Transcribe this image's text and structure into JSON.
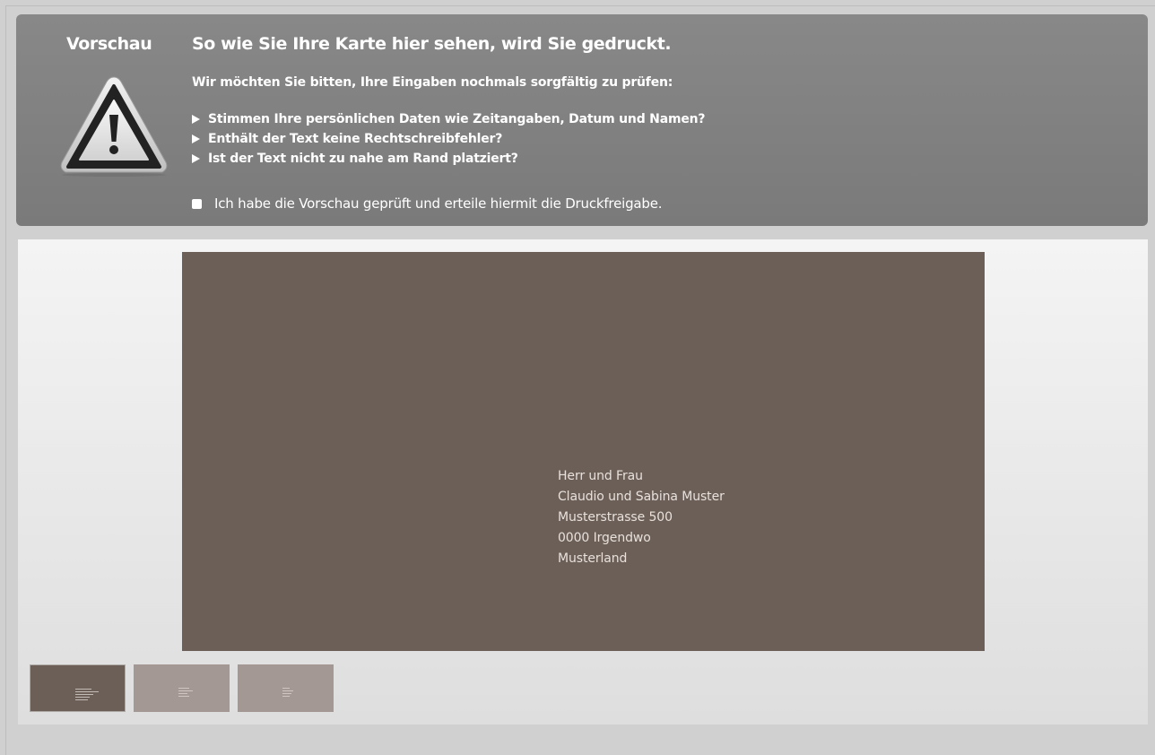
{
  "notice": {
    "label": "Vorschau",
    "title": "So wie Sie Ihre Karte hier sehen, wird Sie gedruckt.",
    "intro": "Wir möchten Sie bitten, Ihre Eingaben nochmals sorgfältig zu prüfen:",
    "checklist": [
      "Stimmen Ihre persönlichen Daten wie Zeitangaben, Datum und Namen?",
      "Enthält der Text keine Rechtschreibfehler?",
      "Ist der Text nicht zu nahe am Rand platziert?"
    ],
    "approval_label": "Ich habe die Vorschau geprüft und erteile hiermit die Druckfreigabe.",
    "approval_checked": false,
    "icon": "warning-triangle-icon"
  },
  "preview": {
    "card_color": "#6c5f57",
    "address_lines": [
      "Herr und Frau",
      "Claudio und Sabina Muster",
      "Musterstrasse 500",
      "0000 Irgendwo",
      "Musterland"
    ],
    "thumbnails": [
      {
        "name": "page-1",
        "active": true
      },
      {
        "name": "page-2",
        "active": false
      },
      {
        "name": "page-3",
        "active": false
      }
    ]
  },
  "colors": {
    "notice_bg": "#828282",
    "card": "#6c5f57",
    "thumb_inactive": "#a39893",
    "page_bg": "#d0d0d0"
  }
}
